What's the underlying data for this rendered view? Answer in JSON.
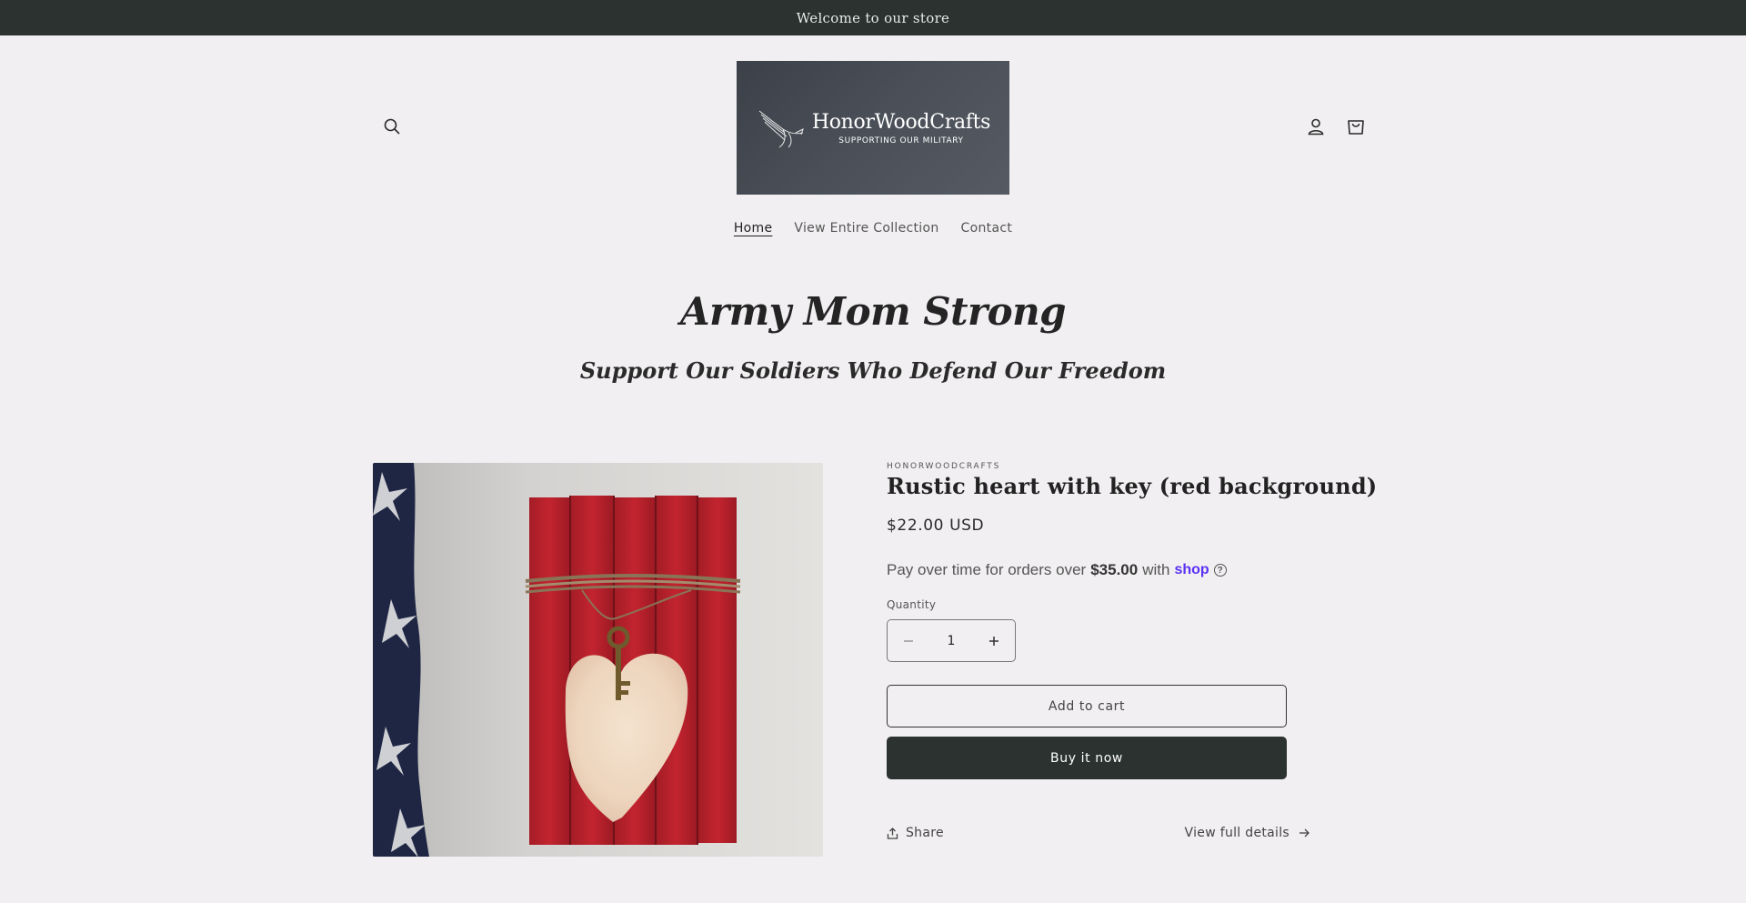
{
  "announcement": {
    "text": "Welcome to our store"
  },
  "header": {
    "logo": {
      "name": "HonorWoodCrafts",
      "tagline": "SUPPORTING OUR MILITARY"
    },
    "icons": {
      "search": "search-icon",
      "account": "account-icon",
      "cart": "cart-icon"
    }
  },
  "nav": {
    "items": [
      {
        "label": "Home",
        "active": true
      },
      {
        "label": "View Entire Collection",
        "active": false
      },
      {
        "label": "Contact",
        "active": false
      }
    ]
  },
  "hero": {
    "title": "Army Mom Strong",
    "subtitle": "Support Our Soldiers Who Defend Our Freedom"
  },
  "product": {
    "vendor": "HONORWOODCRAFTS",
    "title": "Rustic heart with key (red background)",
    "price": "$22.00 USD",
    "installments": {
      "prefix": "Pay over time for orders over",
      "amount": "$35.00",
      "with": "with",
      "provider": "shop"
    },
    "quantity": {
      "label": "Quantity",
      "value": "1"
    },
    "add_to_cart_label": "Add to cart",
    "buy_now_label": "Buy it now",
    "share_label": "Share",
    "view_details_label": "View full details"
  },
  "colors": {
    "background": "#f1eff1",
    "announcement_bg": "#2b3230",
    "primary_button": "#2b3230",
    "shop_pay": "#5a31f4"
  }
}
